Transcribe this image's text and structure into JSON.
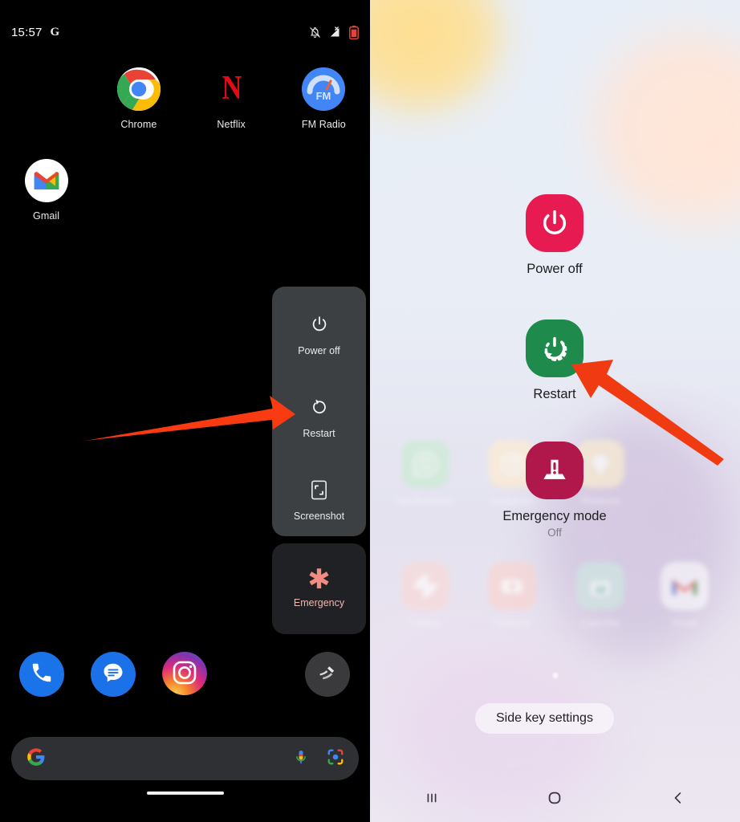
{
  "left_phone": {
    "status_bar": {
      "time": "15:57",
      "assistant_glyph": "G",
      "icons": [
        "notifications-muted-icon",
        "signal-no-service-icon",
        "battery-low-icon"
      ]
    },
    "apps": [
      {
        "label": "Chrome",
        "icon": "chrome-icon"
      },
      {
        "label": "Netflix",
        "icon": "netflix-icon",
        "glyph": "N"
      },
      {
        "label": "FM Radio",
        "icon": "fm-radio-icon",
        "glyph": "FM"
      },
      {
        "label": "Gmail",
        "icon": "gmail-icon"
      }
    ],
    "power_menu": {
      "items": [
        {
          "label": "Power off",
          "icon": "power-off-icon"
        },
        {
          "label": "Restart",
          "icon": "restart-icon"
        },
        {
          "label": "Screenshot",
          "icon": "screenshot-icon"
        }
      ]
    },
    "emergency": {
      "label": "Emergency",
      "icon": "emergency-asterisk-icon",
      "glyph": "✱"
    },
    "dock": [
      {
        "label": "Phone",
        "icon": "phone-icon"
      },
      {
        "label": "Messages",
        "icon": "messages-icon"
      },
      {
        "label": "Instagram",
        "icon": "instagram-icon"
      },
      {
        "label": "Assistant",
        "icon": "assistant-icon"
      }
    ],
    "search": {
      "placeholder": "",
      "value": "",
      "logo": "google-g-icon",
      "mic": "microphone-icon",
      "lens": "google-lens-icon"
    }
  },
  "right_phone": {
    "power_menu": {
      "items": [
        {
          "label": "Power off",
          "sub": "",
          "icon": "power-off-icon",
          "color": "#E81A52"
        },
        {
          "label": "Restart",
          "sub": "",
          "icon": "restart-icon",
          "color": "#1E8A4C"
        },
        {
          "label": "Emergency mode",
          "sub": "Off",
          "icon": "emergency-mode-icon",
          "color": "#B0174A"
        }
      ]
    },
    "side_key_button": {
      "label": "Side key settings"
    },
    "background_apps": [
      {
        "label": "WA Business",
        "icon": "whatsapp-business-icon"
      },
      {
        "label": "Instagram",
        "icon": "instagram-icon"
      },
      {
        "label": "Pinterest",
        "icon": "app-icon"
      },
      {
        "label": "Gallery",
        "icon": "gallery-icon"
      },
      {
        "label": "Camera",
        "icon": "camera-icon"
      },
      {
        "label": "Calendar",
        "icon": "calendar-icon",
        "glyph": "12"
      },
      {
        "label": "Gmail",
        "icon": "gmail-icon"
      }
    ],
    "nav_bar": [
      {
        "label": "Recents",
        "icon": "recents-icon"
      },
      {
        "label": "Home",
        "icon": "home-icon"
      },
      {
        "label": "Back",
        "icon": "back-icon"
      }
    ]
  },
  "annotations": {
    "arrows": [
      {
        "name": "arrow-to-restart-left",
        "color": "#FA3B12",
        "direction": "right"
      },
      {
        "name": "arrow-to-restart-right",
        "color": "#F03A11",
        "direction": "up-left"
      }
    ]
  }
}
